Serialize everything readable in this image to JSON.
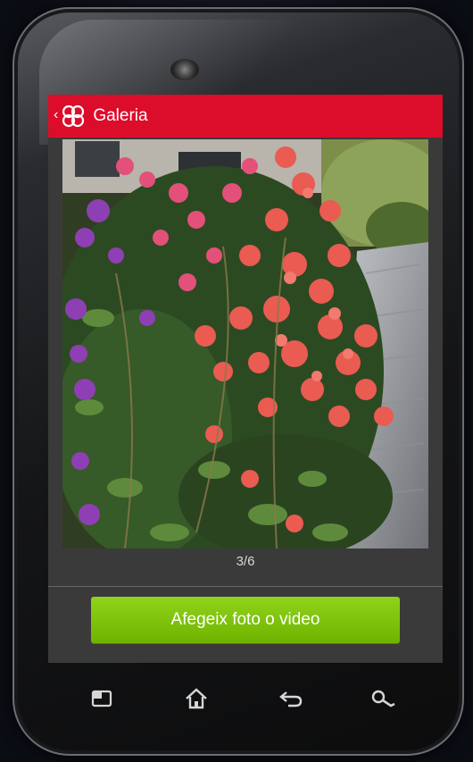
{
  "action_bar": {
    "title": "Galeria",
    "color": "#dc0d2a"
  },
  "gallery": {
    "counter": "3/6"
  },
  "add_button": {
    "label": "Afegeix foto o video",
    "color": "#7cc40a"
  },
  "nav_keys": [
    "menu-icon",
    "home-icon",
    "back-icon",
    "search-icon"
  ]
}
